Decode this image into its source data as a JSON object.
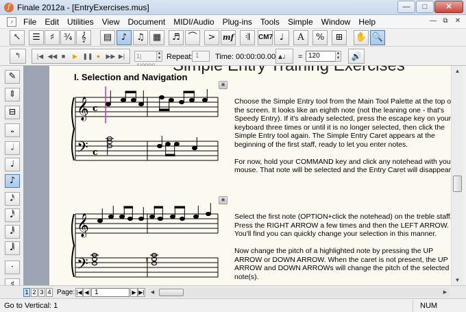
{
  "window": {
    "title": "Finale 2012a - [EntryExercises.mus]",
    "minimize": "—",
    "maximize": "□",
    "close": "✕"
  },
  "menu": {
    "items": [
      "File",
      "Edit",
      "Utilities",
      "View",
      "Document",
      "MIDI/Audio",
      "Plug-ins",
      "Tools",
      "Simple",
      "Window",
      "Help"
    ],
    "mdi_minimize": "—",
    "mdi_restore": "⧉",
    "mdi_close": "✕"
  },
  "toolbar": {
    "cm7_label": "CM7",
    "mf_label": "mf",
    "text_label": "A",
    "percent_label": "%"
  },
  "playback": {
    "counter": "1| 1|0000",
    "repeat_label": "Repeat:",
    "repeat_value": "1",
    "time_label": "Time:",
    "time_value": "00:00:00.000",
    "equals": "=",
    "tempo_value": "120"
  },
  "document": {
    "title": "Simple Entry Training Exercises",
    "heading": "I. Selection and Navigation",
    "exercise1_text": "Choose the Simple Entry tool from the Main Tool Palette at the top of\nthe screen. It looks like an eighth note (not the leaning one - that's\nSpeedy Entry). If it's already selected, press the escape key on your\nkeyboard three times or until it is no longer selected, then click the\nSimple Entry tool again. The Simple Entry Caret appears at the\nbeginning of the first staff, ready to let you enter notes.\n\nFor now, hold your COMMAND key and click any notehead with your\nmouse. That note will be selected and the Entry Caret will disappear.",
    "exercise2_text": "Select the first note (OPTION+click the notehead) on the treble staff.\nPress the RIGHT ARROW a few times and then the LEFT ARROW.\nYou'll find you can quickly change your selection in this manner.\n\nNow change the pitch of a highlighted note by pressing the UP\nARROW or DOWN ARROW. When the caret is not present, the UP\nARROW and DOWN ARROWs will change the pitch of the selected\nnote(s)."
  },
  "pagebar": {
    "tabs": [
      "1",
      "2",
      "3",
      "4"
    ],
    "page_label": "Page:",
    "page_value": "1"
  },
  "status": {
    "text": "Go to Vertical: 1",
    "num": "NUM"
  },
  "colors": {
    "accent": "#4c7fb8",
    "caret": "#cc33cc",
    "page_bg": "#fcfaf0",
    "gutter": "#9da4b3"
  }
}
